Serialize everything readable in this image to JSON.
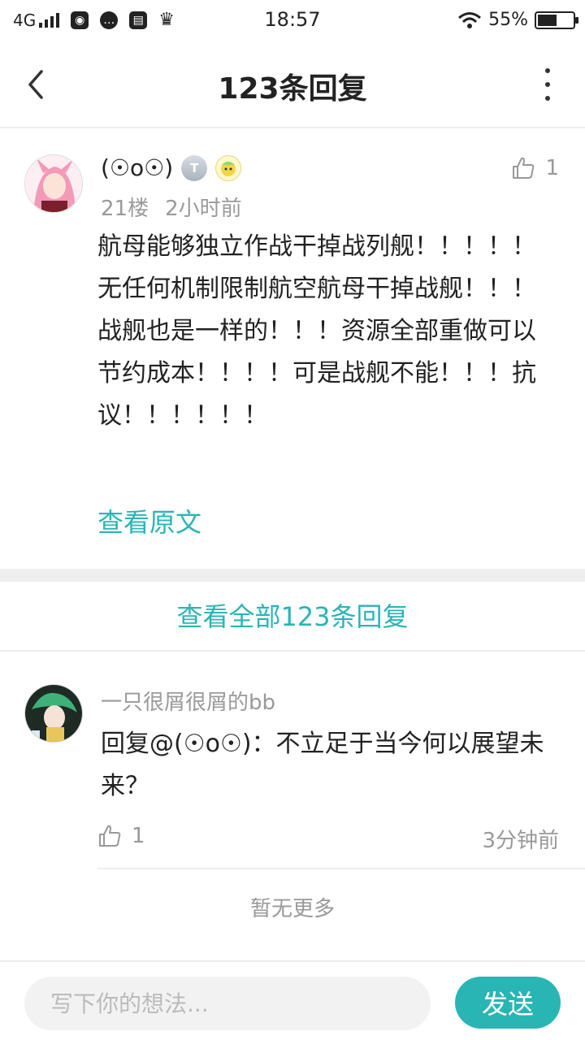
{
  "status_bar": {
    "network": "4G",
    "time": "18:57",
    "battery_text": "55%",
    "battery_level": 0.55,
    "icons": [
      "signal-icon",
      "browser-icon",
      "chat-icon",
      "app-icon",
      "crown-icon",
      "wifi-icon",
      "battery-icon"
    ]
  },
  "header": {
    "title": "123条回复",
    "back_icon": "chevron-left-icon",
    "more_icon": "more-vertical-icon"
  },
  "main_comment": {
    "username": "(☉o☉)",
    "level_badge": "T",
    "floor": "21楼",
    "time": "2小时前",
    "like_count": "1",
    "content": "航母能够独立作战干掉战列舰！！！！！无任何机制限制航空航母干掉战舰！！！战舰也是一样的！！！资源全部重做可以节约成本！！！！可是战舰不能！！！抗议！！！！！！",
    "view_original": "查看原文"
  },
  "view_all_label": "查看全部123条回复",
  "reply": {
    "username": "一只很屑很屑的bb",
    "content": "回复@(☉o☉)：不立足于当今何以展望未来？",
    "like_count": "1",
    "time": "3分钟前"
  },
  "no_more": "暂无更多",
  "composer": {
    "placeholder": "写下你的想法...",
    "send_label": "发送"
  },
  "colors": {
    "accent": "#2ab5b5",
    "muted": "#9a9a9a",
    "divider": "#eeeeee"
  }
}
